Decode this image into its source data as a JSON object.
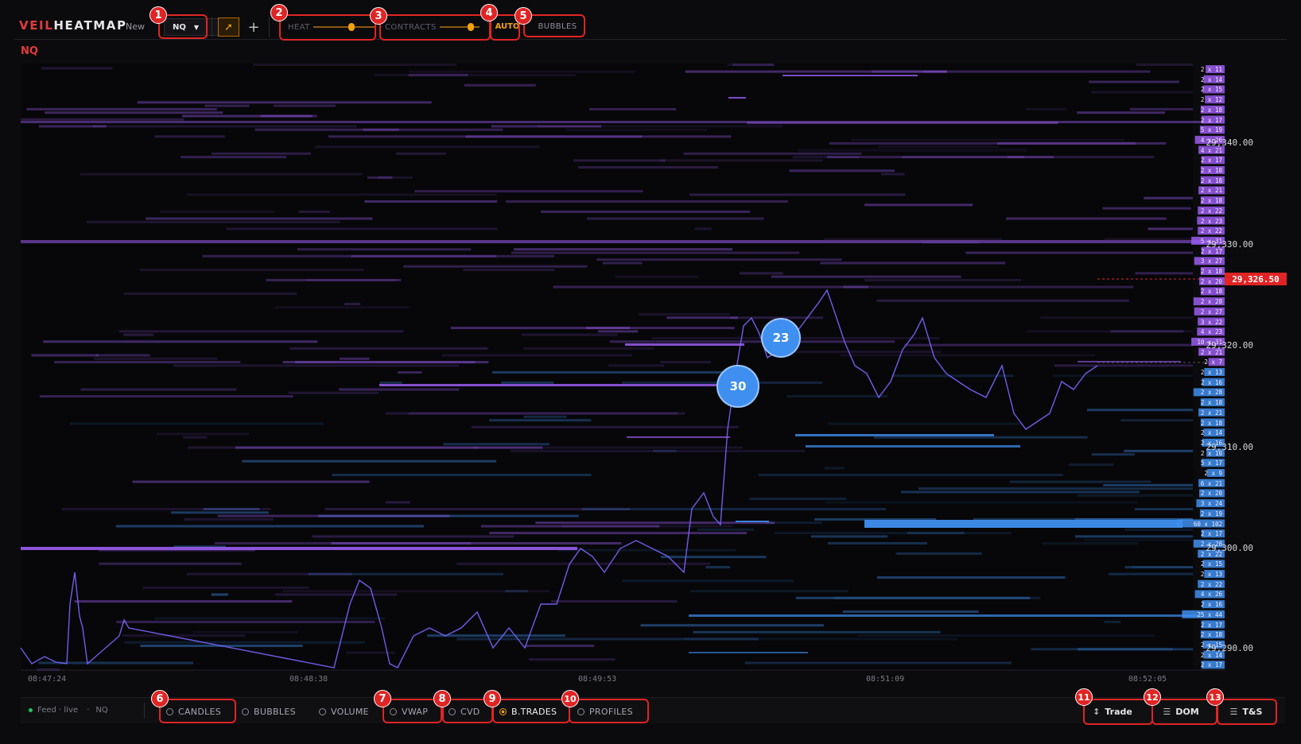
{
  "app": {
    "logo_a": "VEIL",
    "logo_b": "HEATMAP",
    "new_label": "New",
    "symbol": "NQ",
    "symbol_label": "NQ"
  },
  "toolbar": {
    "heat_label": "HEAT",
    "heat_level": 0.62,
    "contracts_label": "CONTRACTS",
    "contracts_level": 0.78,
    "auto_label": "AUTO",
    "bubbles_label": "BUBBLES"
  },
  "callouts": [
    "1",
    "2",
    "3",
    "4",
    "5",
    "6",
    "7",
    "8",
    "9",
    "10",
    "11",
    "12",
    "13"
  ],
  "price_axis": {
    "labels": [
      "29,340.00",
      "29,330.00",
      "29,320.00",
      "29,310.00",
      "29,300.00",
      "29,290.00"
    ],
    "current_price": "29,326.50"
  },
  "time_axis": [
    "08:47:24",
    "08:48:38",
    "08:49:53",
    "08:51:09",
    "08:52:05"
  ],
  "bubbles": [
    {
      "value": "30",
      "color": "#3f8ff0"
    },
    {
      "value": "23",
      "color": "#3f8ff0"
    }
  ],
  "dom_ladder": [
    "2 x 11",
    "2 x 14",
    "2 x 15",
    "2 x 12",
    "2 x 18",
    "2 x 17",
    "5 x 19",
    "4 x 26",
    "4 x 21",
    "2 x 17",
    "2 x 18",
    "2 x 18",
    "2 x 21",
    "2 x 18",
    "2 x 22",
    "2 x 23",
    "2 x 22",
    "5 x 31",
    "2 x 17",
    "3 x 27",
    "2 x 18",
    "2 x 20",
    "2 x 18",
    "2 x 28",
    "2 x 27",
    "3 x 22",
    "4 x 23",
    "10 x 31",
    "2 x 21",
    "2 x 7",
    "2 x 13",
    "2 x 16",
    "2 x 28",
    "2 x 18",
    "2 x 21",
    "2 x 18",
    "2 x 14",
    "2 x 16",
    "2 x 10",
    "5 x 17",
    "2 x 9",
    "6 x 21",
    "2 x 20",
    "3 x 24",
    "2 x 19",
    "60 x 102",
    "2 x 17",
    "2 x 28",
    "2 x 22",
    "2 x 15",
    "2 x 13",
    "2 x 22",
    "4 x 26",
    "2 x 16",
    "25 x 44",
    "2 x 17",
    "2 x 18",
    "2 x 15",
    "2 x 14",
    "2 x 17"
  ],
  "bottom": {
    "feed": "Feed · live",
    "feed_symbol": "NQ",
    "toggles": [
      "CANDLES",
      "BUBBLES",
      "VOLUME",
      "VWAP",
      "CVD",
      "B.TRADES",
      "PROFILES"
    ],
    "active_toggle": "B.TRADES",
    "trade_label": "Trade",
    "dom_label": "DOM",
    "tas_label": "T&S"
  },
  "colors": {
    "accent": "#e23b3b",
    "highlight": "#f2a20f",
    "ask": "#9b5cf0",
    "bid": "#3f8ff0",
    "background": "#0b0b0d"
  },
  "icons": [
    "caret-down-icon",
    "cursor-arrow-icon",
    "crosshair-plus-icon",
    "trade-arrows-icon",
    "dom-list-icon",
    "tas-list-icon"
  ]
}
